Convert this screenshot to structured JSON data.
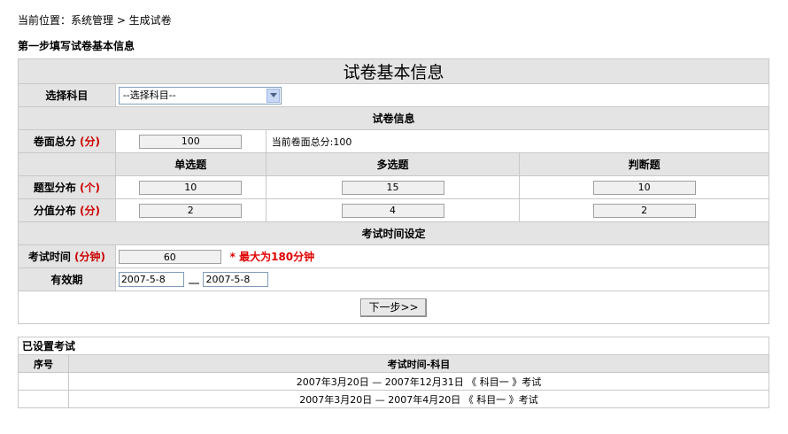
{
  "breadcrumb": {
    "text": "当前位置：系统管理 > 生成试卷"
  },
  "step_title": "第一步填写试卷基本信息",
  "info": {
    "banner": "试卷基本信息",
    "subject_label": "选择科目",
    "subject_select": "--选择科目--",
    "paper_section": "试卷信息",
    "total_score": {
      "label": "卷面总分",
      "unit": "(分)",
      "value": "100",
      "current": "当前卷面总分:100"
    },
    "columns": [
      "单选题",
      "多选题",
      "判断题"
    ],
    "count_row": {
      "label": "题型分布",
      "unit": "(个)",
      "values": [
        "10",
        "15",
        "10"
      ]
    },
    "score_row": {
      "label": "分值分布",
      "unit": "(分)",
      "values": [
        "2",
        "4",
        "2"
      ]
    },
    "time_section": "考试时间设定",
    "duration": {
      "label": "考试时间",
      "unit": "(分钟)",
      "value": "60",
      "note": "* 最大为180分钟"
    },
    "validity": {
      "label": "有效期",
      "start": "2007-5-8",
      "end": "2007-5-8"
    },
    "next_button": "下一步>>"
  },
  "exams": {
    "title": "已设置考试",
    "headers": [
      "序号",
      "考试时间-科目"
    ],
    "rows": [
      {
        "index": "",
        "text": "2007年3月20日 — 2007年12月31日 《 科目一 》考试"
      },
      {
        "index": "",
        "text": "2007年3月20日 — 2007年4月20日 《 科目一 》考试"
      }
    ]
  },
  "colors": {
    "header_gray": "#e4e4e4",
    "accent_red": "#cc0000"
  }
}
